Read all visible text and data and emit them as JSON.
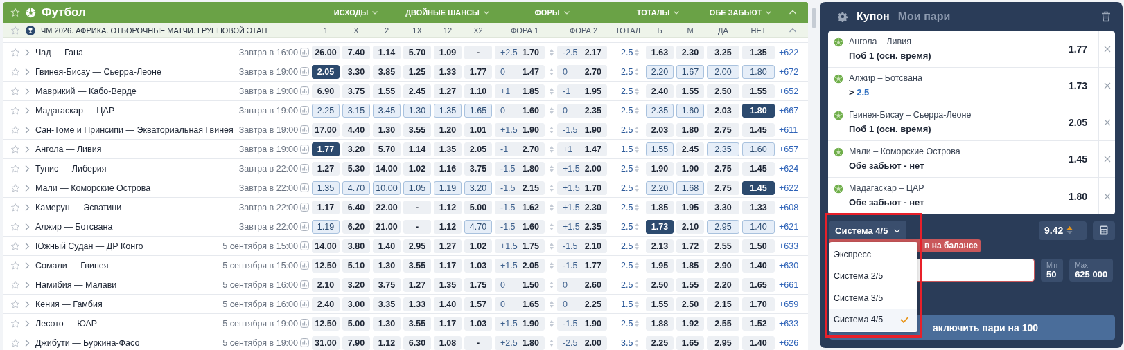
{
  "sport": {
    "title": "Футбол"
  },
  "market_groups": [
    {
      "label": "ИСХОДЫ"
    },
    {
      "label": "ДВОЙНЫЕ ШАНСЫ"
    },
    {
      "label": "ФОРЫ"
    },
    {
      "label": "ТОТАЛЫ"
    },
    {
      "label": "ОБЕ ЗАБЬЮТ"
    }
  ],
  "league": {
    "title": "ЧМ 2026. АФРИКА. ОТБОРОЧНЫЕ МАТЧИ. ГРУППОВОЙ ЭТАП"
  },
  "columns": [
    "1",
    "X",
    "2",
    "1X",
    "12",
    "X2",
    "ФОРА 1",
    "ФОРА 2",
    "ТОТАЛ",
    "Б",
    "М",
    "ДА",
    "НЕТ"
  ],
  "matches": [
    {
      "name": "Чад — Гана",
      "time": "Завтра в 16:00",
      "odds": [
        {
          "value": "26.00",
          "selected": false,
          "highlighted": false
        },
        {
          "value": "7.40",
          "selected": false,
          "highlighted": false
        },
        {
          "value": "1.14",
          "selected": false,
          "highlighted": false
        },
        {
          "value": "5.70",
          "selected": false,
          "highlighted": false
        },
        {
          "value": "1.09",
          "selected": false,
          "highlighted": false
        },
        {
          "value": "-",
          "selected": false,
          "highlighted": false
        }
      ],
      "handicap_1": {
        "line": "+2.5",
        "value": "1.70"
      },
      "handicap_2": {
        "line": "-2.5",
        "value": "2.17"
      },
      "total_line": "2.5",
      "side_odds": [
        {
          "value": "1.63",
          "selected": false,
          "highlighted": false
        },
        {
          "value": "2.30",
          "selected": false,
          "highlighted": false
        },
        {
          "value": "3.25",
          "selected": false,
          "highlighted": false
        },
        {
          "value": "1.35",
          "selected": false,
          "highlighted": false
        }
      ],
      "more": "+622"
    },
    {
      "name": "Гвинея-Бисау — Сьерра-Леоне",
      "time": "Завтра в 19:00",
      "odds": [
        {
          "value": "2.05",
          "selected": true,
          "highlighted": false
        },
        {
          "value": "3.30",
          "selected": false,
          "highlighted": false
        },
        {
          "value": "3.85",
          "selected": false,
          "highlighted": false
        },
        {
          "value": "1.25",
          "selected": false,
          "highlighted": false
        },
        {
          "value": "1.33",
          "selected": false,
          "highlighted": false
        },
        {
          "value": "1.77",
          "selected": false,
          "highlighted": false
        }
      ],
      "handicap_1": {
        "line": "0",
        "value": "1.47"
      },
      "handicap_2": {
        "line": "0",
        "value": "2.70"
      },
      "total_line": "2.5",
      "side_odds": [
        {
          "value": "2.20",
          "selected": false,
          "highlighted": true
        },
        {
          "value": "1.67",
          "selected": false,
          "highlighted": true
        },
        {
          "value": "2.00",
          "selected": false,
          "highlighted": true
        },
        {
          "value": "1.80",
          "selected": false,
          "highlighted": true
        }
      ],
      "more": "+672"
    },
    {
      "name": "Маврикий — Кабо-Верде",
      "time": "Завтра в 19:00",
      "odds": [
        {
          "value": "6.90",
          "selected": false,
          "highlighted": false
        },
        {
          "value": "3.75",
          "selected": false,
          "highlighted": false
        },
        {
          "value": "1.55",
          "selected": false,
          "highlighted": false
        },
        {
          "value": "2.45",
          "selected": false,
          "highlighted": false
        },
        {
          "value": "1.27",
          "selected": false,
          "highlighted": false
        },
        {
          "value": "1.10",
          "selected": false,
          "highlighted": false
        }
      ],
      "handicap_1": {
        "line": "+1",
        "value": "1.85"
      },
      "handicap_2": {
        "line": "-1",
        "value": "1.95"
      },
      "total_line": "2.5",
      "side_odds": [
        {
          "value": "2.40",
          "selected": false,
          "highlighted": false
        },
        {
          "value": "1.55",
          "selected": false,
          "highlighted": false
        },
        {
          "value": "2.50",
          "selected": false,
          "highlighted": false
        },
        {
          "value": "1.55",
          "selected": false,
          "highlighted": false
        }
      ],
      "more": "+652"
    },
    {
      "name": "Мадагаскар — ЦАР",
      "time": "Завтра в 19:00",
      "odds": [
        {
          "value": "2.25",
          "selected": false,
          "highlighted": true
        },
        {
          "value": "3.15",
          "selected": false,
          "highlighted": true
        },
        {
          "value": "3.45",
          "selected": false,
          "highlighted": true
        },
        {
          "value": "1.30",
          "selected": false,
          "highlighted": true
        },
        {
          "value": "1.35",
          "selected": false,
          "highlighted": true
        },
        {
          "value": "1.65",
          "selected": false,
          "highlighted": true
        }
      ],
      "handicap_1": {
        "line": "0",
        "value": "1.60"
      },
      "handicap_2": {
        "line": "0",
        "value": "2.35"
      },
      "total_line": "2.5",
      "side_odds": [
        {
          "value": "2.35",
          "selected": false,
          "highlighted": true
        },
        {
          "value": "1.60",
          "selected": false,
          "highlighted": true
        },
        {
          "value": "2.03",
          "selected": false,
          "highlighted": false
        },
        {
          "value": "1.80",
          "selected": true,
          "highlighted": false
        }
      ],
      "more": "+667"
    },
    {
      "name": "Сан-Томе и Принсипи — Экваториальная Гвинея",
      "time": "Завтра в 19:00",
      "odds": [
        {
          "value": "17.00",
          "selected": false,
          "highlighted": false
        },
        {
          "value": "4.40",
          "selected": false,
          "highlighted": false
        },
        {
          "value": "1.30",
          "selected": false,
          "highlighted": false
        },
        {
          "value": "3.55",
          "selected": false,
          "highlighted": false
        },
        {
          "value": "1.20",
          "selected": false,
          "highlighted": false
        },
        {
          "value": "1.01",
          "selected": false,
          "highlighted": false
        }
      ],
      "handicap_1": {
        "line": "+1.5",
        "value": "1.90"
      },
      "handicap_2": {
        "line": "-1.5",
        "value": "1.90"
      },
      "total_line": "2.5",
      "side_odds": [
        {
          "value": "2.03",
          "selected": false,
          "highlighted": false
        },
        {
          "value": "1.80",
          "selected": false,
          "highlighted": false
        },
        {
          "value": "2.75",
          "selected": false,
          "highlighted": false
        },
        {
          "value": "1.45",
          "selected": false,
          "highlighted": false
        }
      ],
      "more": "+611"
    },
    {
      "name": "Ангола — Ливия",
      "time": "Завтра в 19:00",
      "odds": [
        {
          "value": "1.77",
          "selected": true,
          "highlighted": false
        },
        {
          "value": "3.20",
          "selected": false,
          "highlighted": false
        },
        {
          "value": "5.70",
          "selected": false,
          "highlighted": false
        },
        {
          "value": "1.14",
          "selected": false,
          "highlighted": false
        },
        {
          "value": "1.35",
          "selected": false,
          "highlighted": false
        },
        {
          "value": "2.05",
          "selected": false,
          "highlighted": false
        }
      ],
      "handicap_1": {
        "line": "-1",
        "value": "2.70"
      },
      "handicap_2": {
        "line": "+1",
        "value": "1.47"
      },
      "total_line": "1.5",
      "side_odds": [
        {
          "value": "1.55",
          "selected": false,
          "highlighted": true
        },
        {
          "value": "2.45",
          "selected": false,
          "highlighted": false
        },
        {
          "value": "2.35",
          "selected": false,
          "highlighted": true
        },
        {
          "value": "1.60",
          "selected": false,
          "highlighted": true
        }
      ],
      "more": "+657"
    },
    {
      "name": "Тунис — Либерия",
      "time": "Завтра в 22:00",
      "odds": [
        {
          "value": "1.27",
          "selected": false,
          "highlighted": false
        },
        {
          "value": "5.30",
          "selected": false,
          "highlighted": false
        },
        {
          "value": "14.00",
          "selected": false,
          "highlighted": false
        },
        {
          "value": "1.02",
          "selected": false,
          "highlighted": false
        },
        {
          "value": "1.16",
          "selected": false,
          "highlighted": false
        },
        {
          "value": "3.75",
          "selected": false,
          "highlighted": false
        }
      ],
      "handicap_1": {
        "line": "-1.5",
        "value": "1.80"
      },
      "handicap_2": {
        "line": "+1.5",
        "value": "2.00"
      },
      "total_line": "2.5",
      "side_odds": [
        {
          "value": "1.90",
          "selected": false,
          "highlighted": false
        },
        {
          "value": "1.90",
          "selected": false,
          "highlighted": false
        },
        {
          "value": "2.75",
          "selected": false,
          "highlighted": false
        },
        {
          "value": "1.45",
          "selected": false,
          "highlighted": false
        }
      ],
      "more": "+624"
    },
    {
      "name": "Мали — Коморские Острова",
      "time": "Завтра в 22:00",
      "odds": [
        {
          "value": "1.35",
          "selected": false,
          "highlighted": true
        },
        {
          "value": "4.70",
          "selected": false,
          "highlighted": true
        },
        {
          "value": "10.00",
          "selected": false,
          "highlighted": true
        },
        {
          "value": "1.05",
          "selected": false,
          "highlighted": true
        },
        {
          "value": "1.19",
          "selected": false,
          "highlighted": true
        },
        {
          "value": "3.20",
          "selected": false,
          "highlighted": true
        }
      ],
      "handicap_1": {
        "line": "-1.5",
        "value": "2.15"
      },
      "handicap_2": {
        "line": "+1.5",
        "value": "1.70"
      },
      "total_line": "2.5",
      "side_odds": [
        {
          "value": "2.20",
          "selected": false,
          "highlighted": true
        },
        {
          "value": "1.68",
          "selected": false,
          "highlighted": true
        },
        {
          "value": "2.75",
          "selected": false,
          "highlighted": false
        },
        {
          "value": "1.45",
          "selected": true,
          "highlighted": false
        }
      ],
      "more": "+622"
    },
    {
      "name": "Камерун — Эсватини",
      "time": "Завтра в 22:00",
      "odds": [
        {
          "value": "1.17",
          "selected": false,
          "highlighted": false
        },
        {
          "value": "6.40",
          "selected": false,
          "highlighted": false
        },
        {
          "value": "22.00",
          "selected": false,
          "highlighted": false
        },
        {
          "value": "-",
          "selected": false,
          "highlighted": false
        },
        {
          "value": "1.12",
          "selected": false,
          "highlighted": false
        },
        {
          "value": "5.00",
          "selected": false,
          "highlighted": false
        }
      ],
      "handicap_1": {
        "line": "-1.5",
        "value": "1.62"
      },
      "handicap_2": {
        "line": "+1.5",
        "value": "2.30"
      },
      "total_line": "2.5",
      "side_odds": [
        {
          "value": "1.85",
          "selected": false,
          "highlighted": false
        },
        {
          "value": "1.95",
          "selected": false,
          "highlighted": false
        },
        {
          "value": "3.30",
          "selected": false,
          "highlighted": false
        },
        {
          "value": "1.33",
          "selected": false,
          "highlighted": false
        }
      ],
      "more": "+608"
    },
    {
      "name": "Алжир — Ботсвана",
      "time": "Завтра в 22:00",
      "odds": [
        {
          "value": "1.19",
          "selected": false,
          "highlighted": true
        },
        {
          "value": "6.20",
          "selected": false,
          "highlighted": false
        },
        {
          "value": "21.00",
          "selected": false,
          "highlighted": false
        },
        {
          "value": "-",
          "selected": false,
          "highlighted": false
        },
        {
          "value": "1.12",
          "selected": false,
          "highlighted": false
        },
        {
          "value": "4.70",
          "selected": false,
          "highlighted": true
        }
      ],
      "handicap_1": {
        "line": "-1.5",
        "value": "1.60"
      },
      "handicap_2": {
        "line": "+1.5",
        "value": "2.35"
      },
      "total_line": "2.5",
      "side_odds": [
        {
          "value": "1.73",
          "selected": true,
          "highlighted": false
        },
        {
          "value": "2.10",
          "selected": false,
          "highlighted": false
        },
        {
          "value": "2.95",
          "selected": false,
          "highlighted": true
        },
        {
          "value": "1.40",
          "selected": false,
          "highlighted": true
        }
      ],
      "more": "+621"
    },
    {
      "name": "Южный Судан — ДР Конго",
      "time": "5 сентября в 15:00",
      "odds": [
        {
          "value": "14.00",
          "selected": false,
          "highlighted": false
        },
        {
          "value": "3.80",
          "selected": false,
          "highlighted": false
        },
        {
          "value": "1.40",
          "selected": false,
          "highlighted": false
        },
        {
          "value": "2.95",
          "selected": false,
          "highlighted": false
        },
        {
          "value": "1.27",
          "selected": false,
          "highlighted": false
        },
        {
          "value": "1.02",
          "selected": false,
          "highlighted": false
        }
      ],
      "handicap_1": {
        "line": "+1.5",
        "value": "1.75"
      },
      "handicap_2": {
        "line": "-1.5",
        "value": "2.10"
      },
      "total_line": "2.5",
      "side_odds": [
        {
          "value": "2.13",
          "selected": false,
          "highlighted": false
        },
        {
          "value": "1.72",
          "selected": false,
          "highlighted": false
        },
        {
          "value": "2.55",
          "selected": false,
          "highlighted": false
        },
        {
          "value": "1.50",
          "selected": false,
          "highlighted": false
        }
      ],
      "more": "+633"
    },
    {
      "name": "Сомали — Гвинея",
      "time": "5 сентября в 15:00",
      "odds": [
        {
          "value": "12.50",
          "selected": false,
          "highlighted": false
        },
        {
          "value": "5.10",
          "selected": false,
          "highlighted": false
        },
        {
          "value": "1.30",
          "selected": false,
          "highlighted": false
        },
        {
          "value": "3.55",
          "selected": false,
          "highlighted": false
        },
        {
          "value": "1.17",
          "selected": false,
          "highlighted": false
        },
        {
          "value": "1.03",
          "selected": false,
          "highlighted": false
        }
      ],
      "handicap_1": {
        "line": "+1.5",
        "value": "2.05"
      },
      "handicap_2": {
        "line": "-1.5",
        "value": "1.77"
      },
      "total_line": "2.5",
      "side_odds": [
        {
          "value": "1.95",
          "selected": false,
          "highlighted": false
        },
        {
          "value": "1.85",
          "selected": false,
          "highlighted": false
        },
        {
          "value": "2.90",
          "selected": false,
          "highlighted": false
        },
        {
          "value": "1.40",
          "selected": false,
          "highlighted": false
        }
      ],
      "more": "+630"
    },
    {
      "name": "Намибия — Малави",
      "time": "5 сентября в 16:00",
      "odds": [
        {
          "value": "2.10",
          "selected": false,
          "highlighted": false
        },
        {
          "value": "3.20",
          "selected": false,
          "highlighted": false
        },
        {
          "value": "3.75",
          "selected": false,
          "highlighted": false
        },
        {
          "value": "1.27",
          "selected": false,
          "highlighted": false
        },
        {
          "value": "1.35",
          "selected": false,
          "highlighted": false
        },
        {
          "value": "1.75",
          "selected": false,
          "highlighted": false
        }
      ],
      "handicap_1": {
        "line": "0",
        "value": "1.50"
      },
      "handicap_2": {
        "line": "0",
        "value": "2.60"
      },
      "total_line": "2.5",
      "side_odds": [
        {
          "value": "2.50",
          "selected": false,
          "highlighted": false
        },
        {
          "value": "1.55",
          "selected": false,
          "highlighted": false
        },
        {
          "value": "2.20",
          "selected": false,
          "highlighted": false
        },
        {
          "value": "1.65",
          "selected": false,
          "highlighted": false
        }
      ],
      "more": "+661"
    },
    {
      "name": "Кения — Гамбия",
      "time": "5 сентября в 16:00",
      "odds": [
        {
          "value": "2.40",
          "selected": false,
          "highlighted": false
        },
        {
          "value": "3.00",
          "selected": false,
          "highlighted": false
        },
        {
          "value": "3.35",
          "selected": false,
          "highlighted": false
        },
        {
          "value": "1.33",
          "selected": false,
          "highlighted": false
        },
        {
          "value": "1.40",
          "selected": false,
          "highlighted": false
        },
        {
          "value": "1.57",
          "selected": false,
          "highlighted": false
        }
      ],
      "handicap_1": {
        "line": "0",
        "value": "1.65"
      },
      "handicap_2": {
        "line": "0",
        "value": "2.25"
      },
      "total_line": "1.5",
      "side_odds": [
        {
          "value": "1.55",
          "selected": false,
          "highlighted": false
        },
        {
          "value": "2.50",
          "selected": false,
          "highlighted": false
        },
        {
          "value": "2.15",
          "selected": false,
          "highlighted": false
        },
        {
          "value": "1.70",
          "selected": false,
          "highlighted": false
        }
      ],
      "more": "+659"
    },
    {
      "name": "Лесото — ЮАР",
      "time": "5 сентября в 19:00",
      "odds": [
        {
          "value": "12.50",
          "selected": false,
          "highlighted": false
        },
        {
          "value": "5.00",
          "selected": false,
          "highlighted": false
        },
        {
          "value": "1.30",
          "selected": false,
          "highlighted": false
        },
        {
          "value": "3.55",
          "selected": false,
          "highlighted": false
        },
        {
          "value": "1.17",
          "selected": false,
          "highlighted": false
        },
        {
          "value": "1.03",
          "selected": false,
          "highlighted": false
        }
      ],
      "handicap_1": {
        "line": "+1.5",
        "value": "1.90"
      },
      "handicap_2": {
        "line": "-1.5",
        "value": "1.90"
      },
      "total_line": "2.5",
      "side_odds": [
        {
          "value": "1.88",
          "selected": false,
          "highlighted": false
        },
        {
          "value": "1.92",
          "selected": false,
          "highlighted": false
        },
        {
          "value": "2.55",
          "selected": false,
          "highlighted": false
        },
        {
          "value": "1.52",
          "selected": false,
          "highlighted": false
        }
      ],
      "more": "+633"
    },
    {
      "name": "Джибути — Буркина-Фасо",
      "time": "5 сентября в 19:00",
      "odds": [
        {
          "value": "31.00",
          "selected": false,
          "highlighted": false
        },
        {
          "value": "7.90",
          "selected": false,
          "highlighted": false
        },
        {
          "value": "1.12",
          "selected": false,
          "highlighted": false
        },
        {
          "value": "6.30",
          "selected": false,
          "highlighted": false
        },
        {
          "value": "1.08",
          "selected": false,
          "highlighted": false
        },
        {
          "value": "-",
          "selected": false,
          "highlighted": false
        }
      ],
      "handicap_1": {
        "line": "+2.5",
        "value": "1.80"
      },
      "handicap_2": {
        "line": "-2.5",
        "value": "2.00"
      },
      "total_line": "3.5",
      "side_odds": [
        {
          "value": "2.25",
          "selected": false,
          "highlighted": false
        },
        {
          "value": "1.65",
          "selected": false,
          "highlighted": false
        },
        {
          "value": "2.95",
          "selected": false,
          "highlighted": false
        },
        {
          "value": "1.40",
          "selected": false,
          "highlighted": false
        }
      ],
      "more": "+626"
    }
  ],
  "coupon": {
    "tabs": [
      {
        "label": "Купон",
        "selected": true
      },
      {
        "label": "Мои пари",
        "selected": false
      }
    ],
    "bets": [
      {
        "match": "Ангола – Ливия",
        "kind": "outcome",
        "selection": "Поб 1 (осн. время)",
        "odds": "1.77"
      },
      {
        "match": "Алжир – Ботсвана",
        "kind": "total",
        "sign": ">",
        "selection": "2.5",
        "odds": "1.73"
      },
      {
        "match": "Гвинея-Бисау – Сьерра-Леоне",
        "kind": "outcome",
        "selection": "Поб 1 (осн. время)",
        "odds": "2.05"
      },
      {
        "match": "Мали – Коморские Острова",
        "kind": "outcome",
        "selection": "Обе забьют - нет",
        "odds": "1.45"
      },
      {
        "match": "Мадагаскар – ЦАР",
        "kind": "outcome",
        "selection": "Обе забьют - нет",
        "odds": "1.80"
      }
    ],
    "bet_type": {
      "value": "Система 4/5",
      "options": [
        {
          "label": "Экспресс",
          "selected": false
        },
        {
          "label": "Система 2/5",
          "selected": false
        },
        {
          "label": "Система 3/5",
          "selected": false
        },
        {
          "label": "Система 4/5",
          "selected": true
        }
      ]
    },
    "total_odds": "9.42",
    "warning": "в на балансе",
    "min_label": "Min",
    "min": "50",
    "max_label": "Max",
    "max": "625 000",
    "submit": "аключить пари на 100"
  }
}
